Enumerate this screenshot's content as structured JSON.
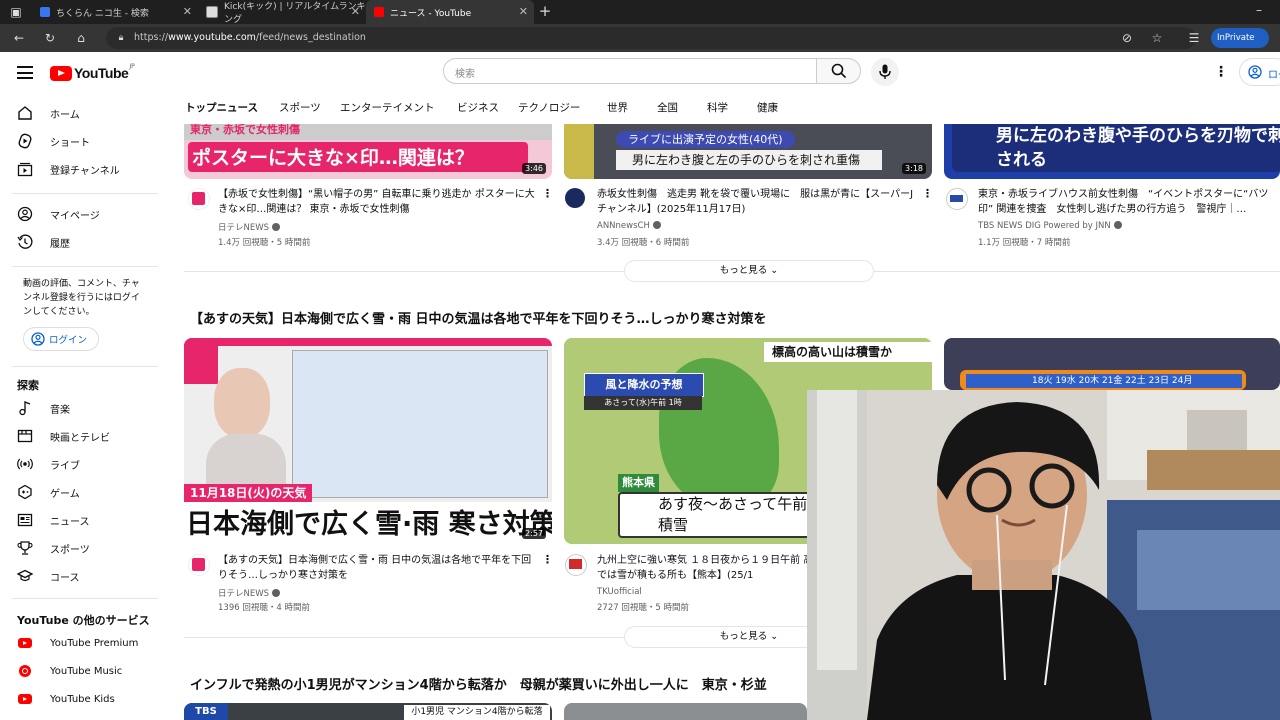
{
  "browser": {
    "tabs": [
      {
        "title": "ちくらん ニコ生 - 検索",
        "active": false
      },
      {
        "title": "Kick(キック) | リアルタイムランキング",
        "active": false
      },
      {
        "title": "ニュース - YouTube",
        "active": true
      }
    ],
    "url_prefix": "https://",
    "url_host": "www.youtube.com",
    "url_path": "/feed/news_destination",
    "inprivate_label": "InPrivate"
  },
  "header": {
    "logo_text": "YouTube",
    "logo_region": "JP",
    "search_placeholder": "検索",
    "login_label": "ログ"
  },
  "sidebar": {
    "main": [
      {
        "label": "ホーム",
        "icon": "home-icon"
      },
      {
        "label": "ショート",
        "icon": "shorts-icon"
      },
      {
        "label": "登録チャンネル",
        "icon": "subscriptions-icon"
      }
    ],
    "you": [
      {
        "label": "マイページ",
        "icon": "account-icon"
      },
      {
        "label": "履歴",
        "icon": "history-icon"
      }
    ],
    "signin_text": "動画の評価、コメント、チャンネル登録を行うにはログインしてください。",
    "login_button": "ログイン",
    "explore_heading": "探索",
    "explore": [
      {
        "label": "音楽",
        "icon": "music-icon"
      },
      {
        "label": "映画とテレビ",
        "icon": "movies-icon"
      },
      {
        "label": "ライブ",
        "icon": "live-icon"
      },
      {
        "label": "ゲーム",
        "icon": "gaming-icon"
      },
      {
        "label": "ニュース",
        "icon": "news-icon"
      },
      {
        "label": "スポーツ",
        "icon": "sports-icon"
      },
      {
        "label": "コース",
        "icon": "courses-icon"
      }
    ],
    "services_heading": "YouTube の他のサービス",
    "services": [
      {
        "label": "YouTube Premium"
      },
      {
        "label": "YouTube Music"
      },
      {
        "label": "YouTube Kids"
      }
    ]
  },
  "chips": [
    "トップニュース",
    "スポーツ",
    "エンターテイメント",
    "ビジネス",
    "テクノロジー",
    "世界",
    "全国",
    "科学",
    "健康"
  ],
  "row1": [
    {
      "title": "【赤坂で女性刺傷】“黒い帽子の男” 自転車に乗り逃走か ポスターに大きな×印…関連は？ 東京・赤坂で女性刺傷",
      "channel": "日テレNEWS",
      "meta": "1.4万 回視聴・5 時間前",
      "duration": "3:46",
      "thumb_text": "ポスターに大きな×印…関連は？",
      "thumb_top": "東京・赤坂で女性刺傷"
    },
    {
      "title": "赤坂女性刺傷　逃走男 靴を袋で覆い現場に　服は黒が青に【スーパーJチャンネル】(2025年11月17日)",
      "channel": "ANNnewsCH",
      "meta": "3.4万 回視聴・6 時間前",
      "duration": "3:18",
      "thumb_label": "ライブに出演予定の女性(40代)",
      "thumb_text": "男に左わき腹と左の手のひらを刺され重傷"
    },
    {
      "title": "東京・赤坂ライブハウス前女性刺傷　“イベントポスターに“バツ印” 関連を捜査　女性刺し逃げた男の行方追う　警視庁｜…",
      "channel": "TBS NEWS DIG Powered by JNN",
      "meta": "1.1万 回視聴・7 時間前",
      "thumb_text": "男に左のわき腹や手のひらを刃物で刺される"
    }
  ],
  "more_label": "もっと見る",
  "section2_title": "【あすの天気】日本海側で広く雪・雨 日中の気温は各地で平年を下回りそう…しっかり寒さ対策を",
  "row2": [
    {
      "title": "【あすの天気】日本海側で広く雪・雨 日中の気温は各地で平年を下回りそう…しっかり寒さ対策を",
      "channel": "日テレNEWS",
      "meta": "1396 回視聴・4 時間前",
      "duration": "2:57",
      "thumb_date": "11月18日(火)の天気",
      "thumb_text": "日本海側で広く雪·雨 寒さ対策を"
    },
    {
      "title": "九州上空に強い寒気 １８日夜から１９日午前 高い山では雪が積もる所も【熊本】(25/1",
      "channel": "TKUofficial",
      "meta": "2727 回視聴・5 時間前",
      "thumb_label": "風と降水の予想",
      "thumb_sub": "あさって(水)午前 1時",
      "thumb_top": "標高の高い山は積雪か",
      "thumb_region": "熊本県",
      "thumb_text": "あす夜～あさって午前 標高の高い山は積雪"
    },
    {
      "thumb_text": "18火 19水 20木 21金 22土 23日 24月"
    }
  ],
  "section3_title": "インフルで発熱の小1男児がマンション4階から転落か　母親が薬買いに外出し一人に　東京・杉並",
  "row3": [
    {
      "thumb_label": "TBS",
      "thumb_text": "小1男児 マンション4階から転落"
    }
  ],
  "colors": {
    "brand_red": "#ff0000",
    "link_blue": "#065fd4",
    "ntv_pink": "#e6256b"
  }
}
